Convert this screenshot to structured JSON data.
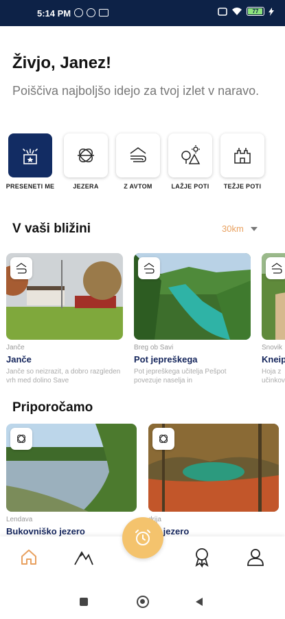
{
  "status_bar": {
    "time": "5:14 PM",
    "battery": "77"
  },
  "greeting": "Živjo, Janez!",
  "subtitle": "Poiščiva najboljšo idejo za tvoj izlet v naravo.",
  "categories": [
    {
      "label": "PRESENETI ME",
      "icon": "gift-icon",
      "active": true
    },
    {
      "label": "JEZERA",
      "icon": "lake-icon",
      "active": false
    },
    {
      "label": "Z AVTOM",
      "icon": "road-icon",
      "active": false
    },
    {
      "label": "LAŽJE POTI",
      "icon": "tree-icon",
      "active": false
    },
    {
      "label": "TEŽJE POTI",
      "icon": "castle-icon",
      "active": false
    }
  ],
  "nearby": {
    "title": "V vaši bližini",
    "range": "30km",
    "cards": [
      {
        "location": "Janče",
        "name": "Janče",
        "description": "Janče so neizrazit, a dobro razgleden vrh med dolino Save",
        "icon": "hill-icon"
      },
      {
        "location": "Breg ob Savi",
        "name": "Pot jepreškega",
        "description": "Pot jepreškega učitelja Pešpot povezuje naselja in",
        "icon": "hill-icon"
      },
      {
        "location": "Snovik",
        "name": "Kneip",
        "description": "Hoja z učinkov",
        "icon": "hill-icon"
      }
    ]
  },
  "recommended": {
    "title": "Priporočamo",
    "cards": [
      {
        "location": "Lendava",
        "name": "Bukovniško jezero",
        "icon": "lake-icon"
      },
      {
        "location": "drija",
        "name": "vje jezero",
        "icon": "lake-icon"
      }
    ]
  },
  "bottom_nav": [
    "home-icon",
    "hiking-icon",
    "alarm-clock-icon",
    "badge-icon",
    "profile-icon"
  ],
  "colors": {
    "brand_navy": "#122c63",
    "accent_orange": "#e8a05e",
    "fab_yellow": "#f4c36d"
  }
}
